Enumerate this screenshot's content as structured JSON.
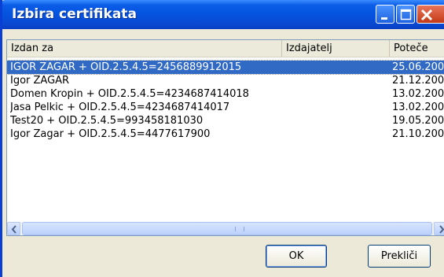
{
  "window": {
    "title": "Izbira certifikata"
  },
  "columns": [
    "Izdan za",
    "Izdajatelj",
    "Poteče"
  ],
  "rows": [
    {
      "name": "IGOR ZAGAR + OID.2.5.4.5=2456889912015",
      "issuer": "",
      "expires": "25.06.200",
      "selected": true
    },
    {
      "name": "Igor ZAGAR",
      "issuer": "",
      "expires": "21.12.200",
      "selected": false
    },
    {
      "name": "Domen Kropin + OID.2.5.4.5=4234687414018",
      "issuer": "",
      "expires": "13.02.200",
      "selected": false
    },
    {
      "name": "Jasa Pelkic + OID.2.5.4.5=4234687414017",
      "issuer": "",
      "expires": "13.02.200",
      "selected": false
    },
    {
      "name": "Test20 + OID.2.5.4.5=993458181030",
      "issuer": "",
      "expires": "19.05.200",
      "selected": false
    },
    {
      "name": "Igor Zagar + OID.2.5.4.5=4477617900",
      "issuer": "",
      "expires": "21.10.200",
      "selected": false
    }
  ],
  "buttons": {
    "ok": "OK",
    "cancel": "Prekliči"
  },
  "icons": [
    "minimize-icon",
    "maximize-icon",
    "close-icon",
    "scroll-left-icon",
    "scroll-right-icon"
  ]
}
